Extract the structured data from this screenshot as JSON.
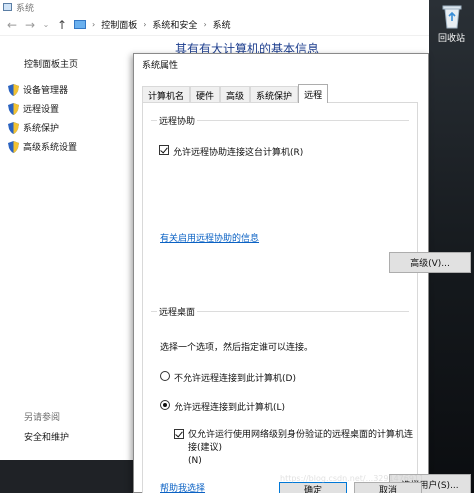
{
  "system_window": {
    "title": "系统",
    "breadcrumb": [
      "控制面板",
      "系统和安全",
      "系统"
    ],
    "background_heading": "其有有大计算机的基本信息"
  },
  "left_panel": {
    "title": "控制面板主页",
    "items": [
      {
        "label": "设备管理器",
        "icon": "shield-icon"
      },
      {
        "label": "远程设置",
        "icon": "shield-icon"
      },
      {
        "label": "系统保护",
        "icon": "shield-icon"
      },
      {
        "label": "高级系统设置",
        "icon": "shield-icon"
      }
    ],
    "see_also": "另请参阅",
    "security": "安全和维护"
  },
  "desktop": {
    "recycle_bin_label": "回收站"
  },
  "dialog": {
    "title": "系统属性",
    "tabs": [
      "计算机名",
      "硬件",
      "高级",
      "系统保护",
      "远程"
    ],
    "active_tab": "远程",
    "remote_assistance": {
      "group_label": "远程协助",
      "allow_checkbox": "允许远程协助连接这台计算机(R)",
      "allow_checked": true,
      "info_link": "有关启用远程协助的信息",
      "advanced_button": "高级(V)..."
    },
    "remote_desktop": {
      "group_label": "远程桌面",
      "instruction": "选择一个选项，然后指定谁可以连接。",
      "option_deny": "不允许远程连接到此计算机(D)",
      "option_allow": "允许远程连接到此计算机(L)",
      "selected": "allow",
      "nla_line1": "仅允许运行使用网络级别身份验证的远程桌面的计算机连接(建议)",
      "nla_line2": "(N)",
      "nla_checked": true,
      "help_link": "帮助我选择",
      "select_users_button": "选择用户(S)..."
    },
    "footer": {
      "ok_button": "确定",
      "cancel_button": "取消"
    }
  },
  "watermark": "https://blog.csdn.net/...3291476911"
}
